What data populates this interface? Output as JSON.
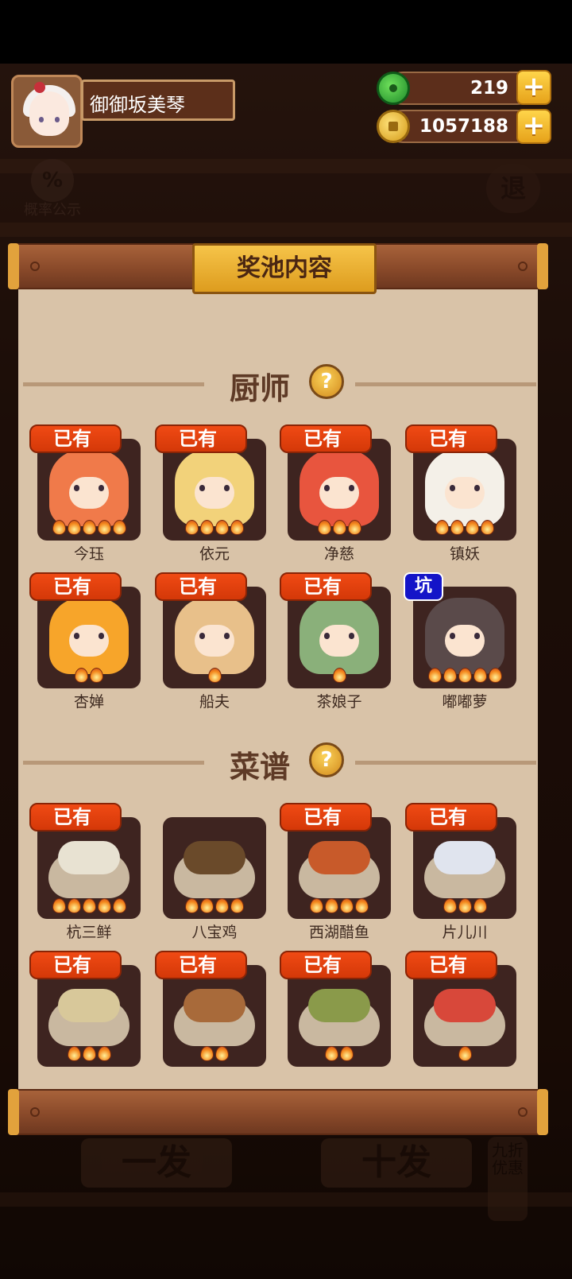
{
  "player": {
    "name": "御御坂美琴"
  },
  "resources": {
    "jade": "219",
    "coins": "1057188",
    "plus": "+"
  },
  "background": {
    "probability_label": "概率公示",
    "probability_symbol": "%",
    "exit_label": "退",
    "single_draw": "一发",
    "ten_draw": "十发",
    "discount": "九折优惠"
  },
  "panel": {
    "title": "奖池内容"
  },
  "chefs": {
    "title": "厨师",
    "help": "?",
    "items": [
      {
        "name": "今珏",
        "badge": "已有",
        "stars": 5,
        "color": "#f07a4a"
      },
      {
        "name": "依元",
        "badge": "已有",
        "stars": 4,
        "color": "#f2d27a"
      },
      {
        "name": "净慈",
        "badge": "已有",
        "stars": 3,
        "color": "#e8553e"
      },
      {
        "name": "镇妖",
        "badge": "已有",
        "stars": 4,
        "color": "#f4f0e8"
      },
      {
        "name": "杏婵",
        "badge": "已有",
        "stars": 2,
        "color": "#f7a52a"
      },
      {
        "name": "船夫",
        "badge": "已有",
        "stars": 1,
        "color": "#e8c08a"
      },
      {
        "name": "茶娘子",
        "badge": "已有",
        "stars": 1,
        "color": "#8ab07a"
      },
      {
        "name": "嘟嘟萝",
        "badge": "坑",
        "stars": 5,
        "color": "#5a4a4a"
      }
    ]
  },
  "recipes": {
    "title": "菜谱",
    "help": "?",
    "items": [
      {
        "name": "杭三鲜",
        "badge": "已有",
        "stars": 5,
        "color": "#e8e2d2"
      },
      {
        "name": "八宝鸡",
        "badge": "",
        "stars": 4,
        "color": "#6a4a2a"
      },
      {
        "name": "西湖醋鱼",
        "badge": "已有",
        "stars": 4,
        "color": "#c85a2a"
      },
      {
        "name": "片儿川",
        "badge": "已有",
        "stars": 3,
        "color": "#e0e4ee"
      },
      {
        "name": "",
        "badge": "已有",
        "stars": 3,
        "color": "#d8c89a"
      },
      {
        "name": "",
        "badge": "已有",
        "stars": 2,
        "color": "#a86a3a"
      },
      {
        "name": "",
        "badge": "已有",
        "stars": 2,
        "color": "#8a9a4a"
      },
      {
        "name": "",
        "badge": "已有",
        "stars": 1,
        "color": "#d8483a"
      }
    ]
  }
}
